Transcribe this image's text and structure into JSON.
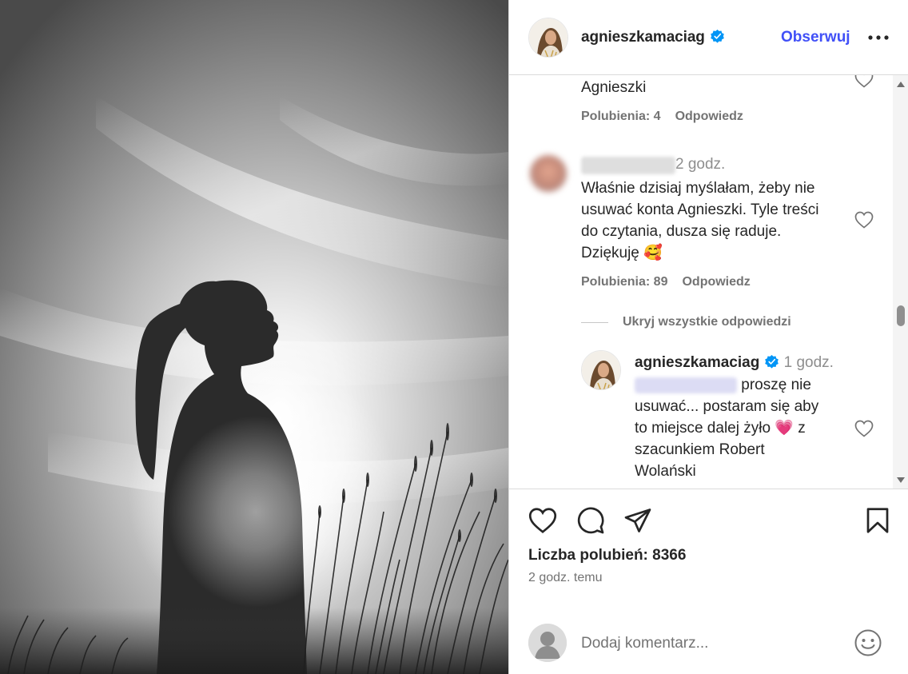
{
  "post": {
    "author": "agnieszkamaciag",
    "follow_label": "Obserwuj",
    "more_icon": "more-horizontal-icon"
  },
  "comments": {
    "partial": {
      "text_tail": "Agnieszki",
      "likes": "Polubienia: 4",
      "reply_label": "Odpowiedz"
    },
    "main": {
      "time": "2 godz.",
      "text_lines": [
        "Właśnie dzisiaj myślałam, żeby nie",
        "usuwać konta Agnieszki. Tyle treści",
        "do czytania, dusza się raduje.",
        "Dziękuję"
      ],
      "emoji": "🥰",
      "likes": "Polubienia: 89",
      "reply_label": "Odpowiedz"
    },
    "hide_replies": "Ukryj wszystkie odpowiedzi",
    "reply": {
      "author": "agnieszkamaciag",
      "time": "1 godz.",
      "text_lines": [
        "proszę nie",
        "usuwać... postaram się aby",
        "to miejsce dalej żyło",
        "szacunkiem Robert",
        "Wolański"
      ],
      "line3_end": "z",
      "emoji": "💗"
    }
  },
  "actions": {
    "likes_text": "Liczba polubień: 8366",
    "posted_time": "2 godz. temu"
  },
  "add_comment": {
    "placeholder": "Dodaj komentarz..."
  },
  "colors": {
    "accent": "#4150f7",
    "verified": "#0095f6",
    "heart_red": "#ed4956"
  }
}
